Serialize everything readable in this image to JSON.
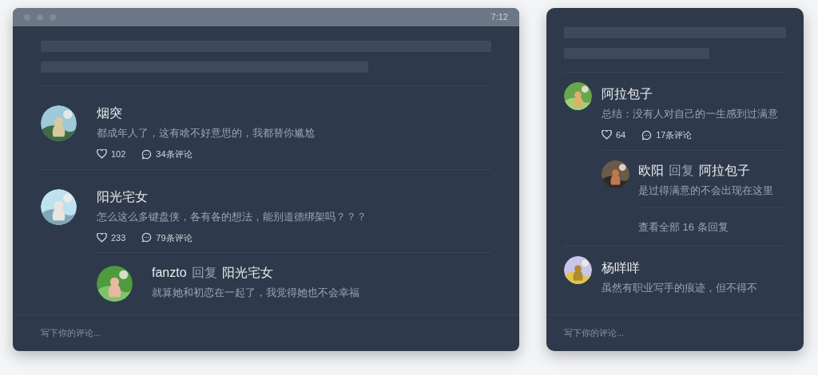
{
  "windows": [
    {
      "kind": "desktop",
      "time": "7:12",
      "comments": [
        {
          "author": "烟突",
          "text": "都成年人了，这有啥不好意思的，我都替你尴尬",
          "likes": "102",
          "comment_count": "34条评论"
        },
        {
          "author": "阳光宅女",
          "text": "怎么这么多键盘侠，各有各的想法，能别道德绑架吗？？？",
          "likes": "233",
          "comment_count": "79条评论",
          "replies": [
            {
              "author": "fanzto",
              "reply_word": "回复",
              "target": "阳光宅女",
              "text": "就算她和初恋在一起了，我觉得她也不会幸福"
            }
          ]
        }
      ],
      "input": {
        "placeholder": "写下你的评论..."
      }
    },
    {
      "kind": "mobile",
      "comments": [
        {
          "author": "阿拉包子",
          "text": "总结：没有人对自己的一生感到过满意",
          "likes": "64",
          "comment_count": "17条评论",
          "replies": [
            {
              "author": "欧阳",
              "reply_word": "回复",
              "target": "阿拉包子",
              "text": "是过得满意的不会出现在这里"
            }
          ],
          "more": "查看全部 16 条回复"
        },
        {
          "author": "杨咩咩",
          "text": "虽然有职业写手的痕迹，但不得不"
        }
      ],
      "input": {
        "placeholder": "写下你的评论..."
      }
    }
  ]
}
